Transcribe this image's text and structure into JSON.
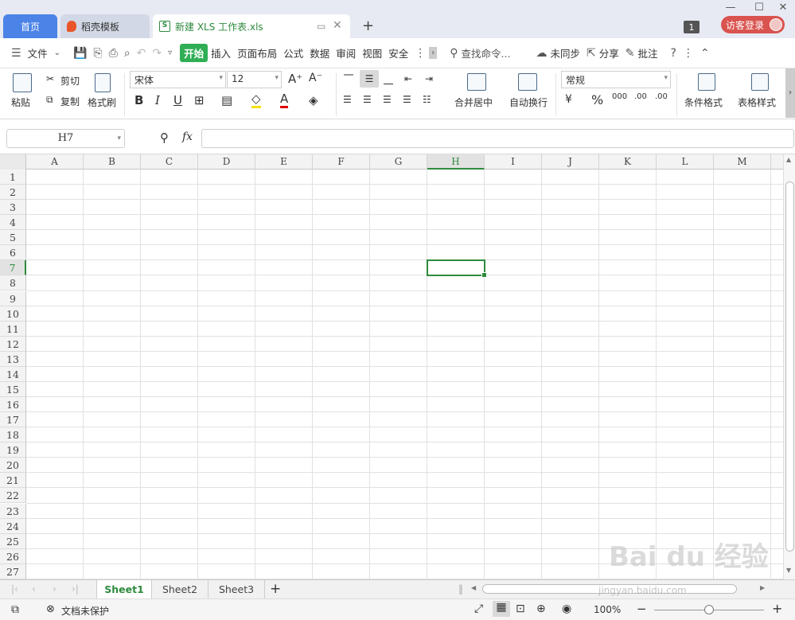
{
  "tabs": {
    "home": "首页",
    "daoke": "稻壳模板",
    "file": "新建 XLS 工作表.xls"
  },
  "badge": "1",
  "login": "访客登录",
  "menu": {
    "file": "文件",
    "start": "开始",
    "items": [
      "插入",
      "页面布局",
      "公式",
      "数据",
      "审阅",
      "视图",
      "安全"
    ],
    "search": "查找命令...",
    "sync": "未同步",
    "share": "分享",
    "comment": "批注"
  },
  "ribbon": {
    "paste": "粘贴",
    "cut": "剪切",
    "copy": "复制",
    "format_painter": "格式刷",
    "font": "宋体",
    "size": "12",
    "merge": "合并居中",
    "wrap": "自动换行",
    "numfmt": "常规",
    "cond": "条件格式",
    "tablestyle": "表格样式"
  },
  "namebox": "H7",
  "fx": "fx",
  "columns": [
    "A",
    "B",
    "C",
    "D",
    "E",
    "F",
    "G",
    "H",
    "I",
    "J",
    "K",
    "L",
    "M"
  ],
  "rows": [
    "1",
    "2",
    "3",
    "4",
    "5",
    "6",
    "7",
    "8",
    "9",
    "10",
    "11",
    "12",
    "13",
    "14",
    "15",
    "16",
    "17",
    "18",
    "19",
    "20",
    "21",
    "22",
    "23",
    "24",
    "25",
    "26",
    "27"
  ],
  "active": {
    "col": "H",
    "row": "7"
  },
  "sheets": [
    "Sheet1",
    "Sheet2",
    "Sheet3"
  ],
  "status": {
    "protect": "文档未保护",
    "zoom": "100%"
  },
  "watermark": {
    "logo": "Bai du 经验",
    "url": "jingyan.baidu.com"
  }
}
